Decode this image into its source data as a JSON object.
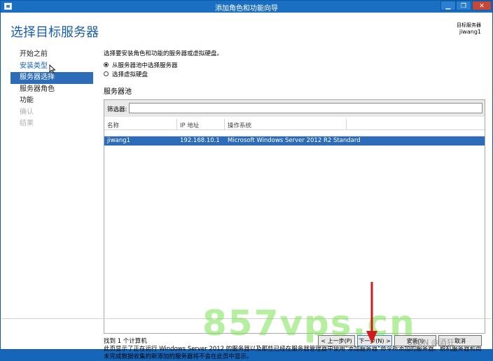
{
  "window": {
    "title": "添加角色和功能向导",
    "min_glyph": "▁",
    "max_glyph": "❐",
    "close_glyph": "✕"
  },
  "header": {
    "page_title": "选择目标服务器",
    "destination_label": "目标服务器",
    "destination_server": "jiwang1"
  },
  "sidebar": {
    "items": [
      {
        "label": "开始之前",
        "state": "normal"
      },
      {
        "label": "安装类型",
        "state": "link"
      },
      {
        "label": "服务器选择",
        "state": "active"
      },
      {
        "label": "服务器角色",
        "state": "normal"
      },
      {
        "label": "功能",
        "state": "normal"
      },
      {
        "label": "确认",
        "state": "disabled"
      },
      {
        "label": "结果",
        "state": "disabled"
      }
    ]
  },
  "content": {
    "instruction": "选择要安装角色和功能的服务器或虚拟硬盘。",
    "radio_pool": "从服务器池中选择服务器",
    "radio_vhd": "选择虚拟硬盘",
    "section_title": "服务器池",
    "filter_label": "筛选器:",
    "filter_value": "",
    "columns": {
      "name": "名称",
      "ip": "IP 地址",
      "os": "操作系统"
    },
    "rows": [
      {
        "name": "jiwang1",
        "ip": "192.168.10.1",
        "os": "Microsoft Windows Server 2012 R2 Standard"
      }
    ],
    "found_text": "找到 1 个计算机",
    "note": "此页显示了正在运行 Windows Server 2012 的服务器以及那些已经在服务器管理器中使用\"添加服务器\"命令所添加的服务器。脱机服务器和尚未完成数据收集的新添加的服务器将不会在此页中显示。"
  },
  "buttons": {
    "prev": "< 上一步(P)",
    "next": "下一步(N) >",
    "install": "安装(I)",
    "cancel": "取消"
  },
  "overlay": {
    "watermark": "857vps.cn",
    "credit": "CSDN @酒狂"
  },
  "colors": {
    "titlebar": "#1b6fc2",
    "accent": "#2d6cb9",
    "title_text": "#1b5ea8",
    "watermark": "#78e150",
    "annotation_arrow": "#d11a1a"
  }
}
